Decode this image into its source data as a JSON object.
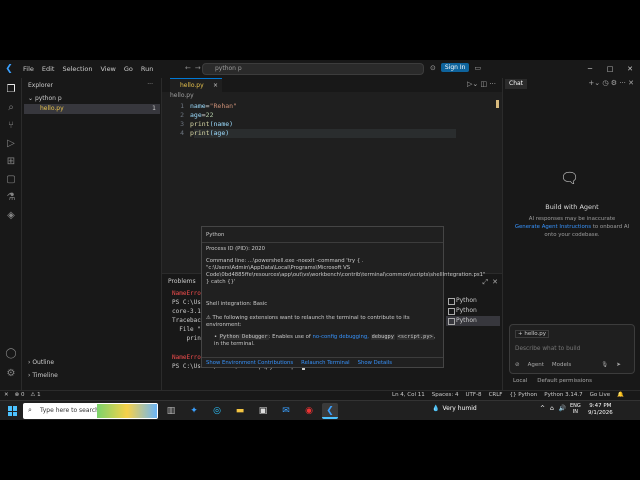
{
  "titlebar": {
    "menu": [
      "File",
      "Edit",
      "Selection",
      "View",
      "Go",
      "Run"
    ],
    "command_center": "python p",
    "signin": "Sign In"
  },
  "sidebar": {
    "header": "Explorer",
    "folder": "python p",
    "file": "hello.py",
    "file_badge": "1",
    "outline": "Outline",
    "timeline": "Timeline"
  },
  "editor": {
    "tab": "hello.py",
    "breadcrumb": "hello.py",
    "lines": [
      {
        "n": "1",
        "parts": [
          "name",
          "=",
          "\"Rehan\""
        ]
      },
      {
        "n": "2",
        "parts": [
          "age",
          "=",
          "22"
        ]
      },
      {
        "n": "3",
        "parts": [
          "print",
          "(name)"
        ]
      },
      {
        "n": "4",
        "parts": [
          "print",
          "(age)"
        ]
      }
    ]
  },
  "panel": {
    "tab": "Problems",
    "terminal_lines": [
      {
        "t": "NameErro",
        "err": true
      },
      {
        "t": "PS C:\\Us",
        "err": false
      },
      {
        "t": "core-3.1",
        "err": false
      },
      {
        "t": "Traceback",
        "err": false
      },
      {
        "t": "  File \"",
        "err": false
      },
      {
        "t": "    print",
        "err": false
      },
      {
        "t": "NameErro",
        "err": true
      }
    ],
    "prompt": "PS C:\\Users\\Admin\\Desktop\\python p> ",
    "terminals": [
      "Python",
      "Python",
      "Python"
    ]
  },
  "hover": {
    "title": "Python",
    "pid": "Process ID (PID): 2020",
    "cmd": "Command line: ...\\powershell.exe -noexit -command 'try { . \"c:\\Users\\Admin\\AppData\\Local\\Programs\\Microsoft VS Code\\0bd4885ffe\\resources\\app\\out\\vs\\workbench\\contrib\\terminal\\common\\scripts\\shellIntegration.ps1\" } catch {}'",
    "shell": "Shell integration: Basic",
    "warn": "The following extensions want to relaunch the terminal to contribute to its environment:",
    "ext_name": "Python Debugger",
    "ext_text": ": Enables use of",
    "ext_link": "no-config debugging,",
    "ext_code1": "debugpy",
    "ext_code2": "<script.py>",
    "ext_end": ", in the terminal.",
    "footer": [
      "Show Environment Contributions",
      "Relaunch Terminal",
      "Show Details"
    ]
  },
  "chat": {
    "tab": "Chat",
    "title": "Build with Agent",
    "desc1": "AI responses may be inaccurate",
    "desc_link": "Generate Agent Instructions",
    "desc2": "to onboard AI onto your codebase.",
    "context_file": "hello.py",
    "placeholder": "Describe what to build",
    "tools": [
      "Agent",
      "Models"
    ],
    "bottom": [
      "Local",
      "Default permissions"
    ]
  },
  "statusbar": {
    "left": [
      "⊗ 0",
      "⚠ 1"
    ],
    "right": [
      "Ln 4, Col 11",
      "Spaces: 4",
      "UTF-8",
      "CRLF",
      "{} Python",
      "Python 3.14.7",
      "Go Live"
    ]
  },
  "taskbar": {
    "search": "Type here to search",
    "weather": "Very humid",
    "lang1": "ENG",
    "lang2": "IN",
    "time": "9:47 PM",
    "date": "9/1/2026"
  }
}
